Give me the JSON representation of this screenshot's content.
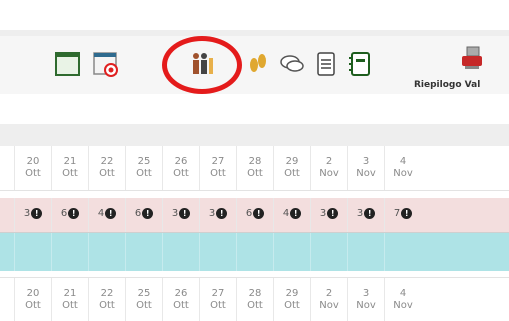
{
  "toolbar": {
    "icons": [
      {
        "name": "calendar-window-icon"
      },
      {
        "name": "calendar-target-icon"
      },
      {
        "name": "people-group-icon"
      },
      {
        "name": "footprints-icon"
      },
      {
        "name": "chat-bubbles-icon"
      },
      {
        "name": "document-icon"
      },
      {
        "name": "notebook-icon"
      },
      {
        "name": "pdf-stamp-icon"
      }
    ],
    "summary_label": "Riepilogo Val"
  },
  "dates": [
    {
      "day": "20",
      "month": "Ott"
    },
    {
      "day": "21",
      "month": "Ott"
    },
    {
      "day": "22",
      "month": "Ott"
    },
    {
      "day": "25",
      "month": "Ott"
    },
    {
      "day": "26",
      "month": "Ott"
    },
    {
      "day": "27",
      "month": "Ott"
    },
    {
      "day": "28",
      "month": "Ott"
    },
    {
      "day": "29",
      "month": "Ott"
    },
    {
      "day": "2",
      "month": "Nov"
    },
    {
      "day": "3",
      "month": "Nov"
    },
    {
      "day": "4",
      "month": "Nov"
    }
  ],
  "counts": [
    "3",
    "6",
    "4",
    "6",
    "3",
    "3",
    "6",
    "4",
    "3",
    "3",
    "7"
  ],
  "count_badge": "!",
  "colors": {
    "highlight": "#e41b1b",
    "count_row": "#f3dede",
    "cyan_row": "#aee3e6"
  }
}
